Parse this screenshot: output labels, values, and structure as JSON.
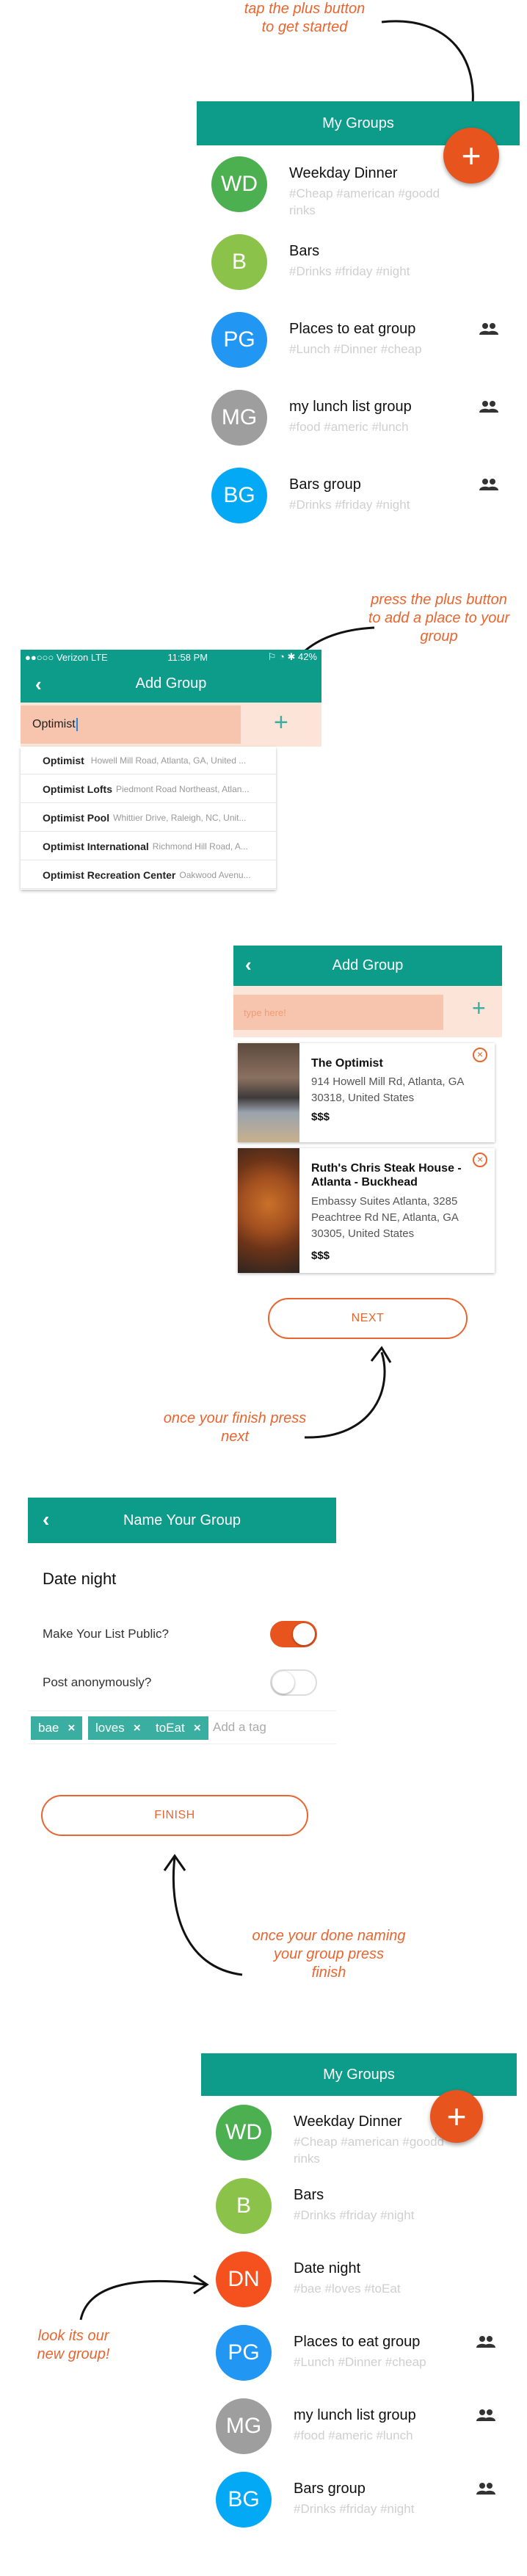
{
  "step1": {
    "note": "tap the plus button\nto get started",
    "title": "My Groups",
    "fab": "+",
    "groups": [
      {
        "initials": "WD",
        "color": "#4caf50",
        "name": "Weekday Dinner",
        "tags": "#Cheap #american #goodd\nrinks",
        "shared": false
      },
      {
        "initials": "B",
        "color": "#8bc34a",
        "name": "Bars",
        "tags": "#Drinks #friday #night",
        "shared": false
      },
      {
        "initials": "PG",
        "color": "#2196f3",
        "name": "Places to eat group",
        "tags": "#Lunch #Dinner #cheap",
        "shared": true
      },
      {
        "initials": "MG",
        "color": "#9e9e9e",
        "name": "my lunch list group",
        "tags": "#food #americ #lunch",
        "shared": true
      },
      {
        "initials": "BG",
        "color": "#03a9f4",
        "name": "Bars group",
        "tags": "#Drinks #friday #night",
        "shared": true
      }
    ]
  },
  "step2": {
    "note": "press the plus button\nto add a place to your\ngroup",
    "status": {
      "carrier": "●●○○○ Verizon  LTE",
      "time": "11:58 PM",
      "battery": "⚐ ◔ ✱ 42%"
    },
    "title": "Add Group",
    "search_value": "Optimist",
    "plus": "+",
    "suggestions": [
      {
        "bold": "Optimist",
        "rest": "",
        "addr": "Howell Mill Road, Atlanta, GA, United ..."
      },
      {
        "bold": "Optimist",
        "rest": "Lofts",
        "addr": "Piedmont Road Northeast, Atlan..."
      },
      {
        "bold": "Optimist",
        "rest": "Pool",
        "addr": "Whittier Drive, Raleigh, NC, Unit..."
      },
      {
        "bold": "Optimist",
        "rest": "International",
        "addr": "Richmond Hill Road, A..."
      },
      {
        "bold": "Optimist",
        "rest": "Recreation Center",
        "addr": "Oakwood Avenu..."
      }
    ]
  },
  "step3": {
    "title": "Add Group",
    "placeholder": "type here!",
    "plus": "+",
    "places": [
      {
        "name": "The Optimist",
        "address": "914 Howell Mill Rd, Atlanta, GA\n30318, United States",
        "price": "$$$"
      },
      {
        "name": "Ruth's Chris Steak House -\nAtlanta - Buckhead",
        "address": "Embassy Suites Atlanta, 3285\nPeachtree Rd NE, Atlanta, GA\n30305, United States",
        "price": "$$$"
      }
    ],
    "next_label": "NEXT",
    "note": "once your finish press\nnext"
  },
  "step4": {
    "title": "Name Your Group",
    "group_name": "Date night",
    "public_label": "Make Your List Public?",
    "public_on": true,
    "anon_label": "Post anonymously?",
    "anon_on": false,
    "tags": [
      "bae",
      "loves",
      "toEat"
    ],
    "tag_placeholder": "Add a tag",
    "finish_label": "FINISH",
    "note": "once your done naming\nyour group press\nfinish"
  },
  "step5": {
    "title": "My Groups",
    "fab": "+",
    "note": "look its our\nnew group!",
    "groups": [
      {
        "initials": "WD",
        "color": "#4caf50",
        "name": "Weekday Dinner",
        "tags": "#Cheap #american #goodd\nrinks",
        "shared": false
      },
      {
        "initials": "B",
        "color": "#8bc34a",
        "name": "Bars",
        "tags": "#Drinks #friday #night",
        "shared": false
      },
      {
        "initials": "DN",
        "color": "#f4511e",
        "name": "Date night",
        "tags": "#bae #loves #toEat",
        "shared": false
      },
      {
        "initials": "PG",
        "color": "#2196f3",
        "name": "Places to eat group",
        "tags": "#Lunch #Dinner #cheap",
        "shared": true
      },
      {
        "initials": "MG",
        "color": "#9e9e9e",
        "name": "my lunch list group",
        "tags": "#food #americ #lunch",
        "shared": true
      },
      {
        "initials": "BG",
        "color": "#03a9f4",
        "name": "Bars group",
        "tags": "#Drinks #friday #night",
        "shared": true
      }
    ]
  },
  "colors": {
    "teal": "#0d9b8a",
    "accent": "#e8652f",
    "fab": "#e8541e",
    "input_bg": "#f7c4ad"
  }
}
